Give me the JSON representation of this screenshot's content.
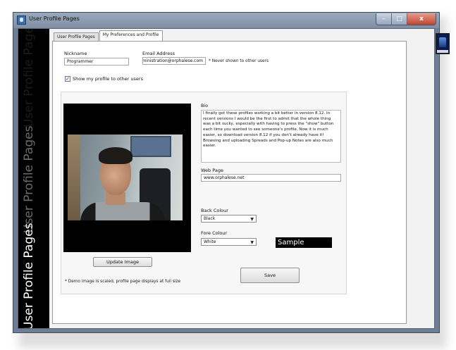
{
  "window": {
    "title": "User Profile Pages",
    "minimize_icon": "minimize-icon",
    "maximize_icon": "maximize-icon",
    "close_icon": "close-icon",
    "minimize_glyph": "–",
    "maximize_glyph": "□",
    "close_glyph": "x"
  },
  "sidebar": {
    "banner_text": "User Profile Pages"
  },
  "tabs": [
    {
      "label": "User Profile Pages",
      "active": false
    },
    {
      "label": "My Preferences and Profile",
      "active": true
    }
  ],
  "form": {
    "nickname_label": "Nickname",
    "nickname_value": "Programmer",
    "email_label": "Email Address",
    "email_value": "administration@orphalese.com",
    "email_note": "* Never shown to other users",
    "show_profile_label": "Show my profile to other users",
    "show_profile_checked": true,
    "checkmark": "✓",
    "bio_label": "Bio",
    "bio_text": "I finally got these profiles working a bit better in version 8.12. In recent versions I would be the first to admit that the whole thing was a bit sucky, especially with having to press the \"show\" button each time you wanted to see someone's profile. Now it is much easier, so download version 8.12 if you don't already have it! Browsing and uploading Spreads and Pop-up Notes are also much easier.",
    "webpage_label": "Web Page",
    "webpage_value": "www.orphalese.net",
    "back_colour_label": "Back Colour",
    "back_colour_value": "Black",
    "fore_colour_label": "Fore Colour",
    "fore_colour_value": "White",
    "dropdown_glyph": "▼",
    "sample_label": "Sample",
    "update_image_label": "Update Image",
    "demo_note": "* Demo image is scaled, profile page displays at full size",
    "save_label": "Save"
  },
  "colors": {
    "accent": "#6e7f95",
    "sample_bg": "#000000",
    "sample_fg": "#ffffff"
  }
}
